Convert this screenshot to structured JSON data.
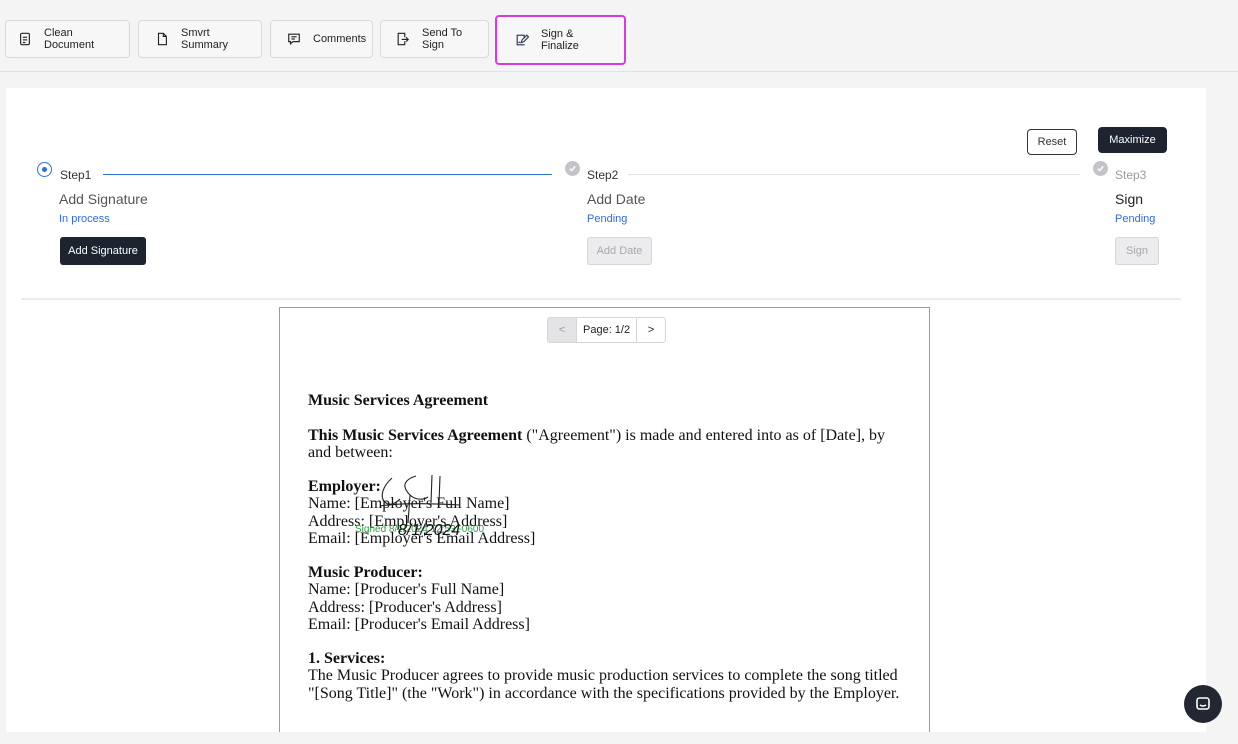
{
  "toolbar": {
    "buttons": [
      {
        "label": "Clean Document",
        "icon": "document-text-icon"
      },
      {
        "label": "Smvrt Summary",
        "icon": "file-icon"
      },
      {
        "label": "Comments",
        "icon": "comment-icon"
      },
      {
        "label": "Send To Sign",
        "icon": "send-file-icon"
      },
      {
        "label": "Sign & Finalize",
        "icon": "sign-pen-icon",
        "active": true
      }
    ]
  },
  "controls": {
    "reset_label": "Reset",
    "maximize_label": "Maximize"
  },
  "steps": [
    {
      "title": "Step1",
      "subtitle": "Add Signature",
      "status": "In process",
      "action": "Add Signature",
      "state": "active"
    },
    {
      "title": "Step2",
      "subtitle": "Add Date",
      "status": "Pending",
      "action": "Add Date",
      "state": "pending"
    },
    {
      "title": "Step3",
      "subtitle": "Sign",
      "status": "Pending",
      "action": "Sign",
      "state": "pending"
    }
  ],
  "pager": {
    "prev": "<",
    "label": "Page: 1/2",
    "next": ">"
  },
  "document": {
    "title": "Music Services Agreement",
    "intro_bold": "This Music Services Agreement",
    "intro_rest": " (\"Agreement\") is made and entered into as of [Date], by and between:",
    "employer_heading": "Employer:",
    "employer_name": "Name: [Employer's Full Name]",
    "employer_address": "Address: [Employer's Address]",
    "employer_email": "Email: [Employer's Email Address]",
    "producer_heading": "Music Producer:",
    "producer_name": "Name: [Producer's Full Name]",
    "producer_address": "Address: [Producer's Address]",
    "producer_email": "Email: [Producer's Email Address]",
    "services_heading": "1. Services:",
    "services_text": "The Music Producer agrees to provide music production services to complete the song titled \"[Song Title]\" (the \"Work\") in accordance with the specifications provided by the Employer."
  },
  "signature": {
    "stamp": "Signed 8/1/2024 12:53 -0600",
    "date": "8/1/2024"
  },
  "colors": {
    "accent": "#2f6fd6",
    "active_outline": "#d63be0",
    "dark_button": "#1e2330",
    "signed_green": "#2f9e44"
  }
}
